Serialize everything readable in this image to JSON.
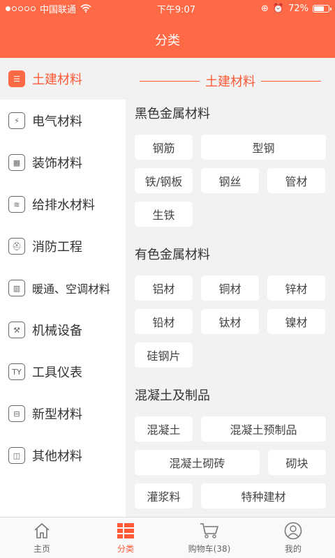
{
  "status": {
    "carrier": "中国联通",
    "time": "下午9:07",
    "battery": "72%",
    "battery_level": 0.72
  },
  "header": {
    "title": "分类"
  },
  "sidebar": {
    "items": [
      {
        "label": "土建材料",
        "icon": "document-icon",
        "active": true
      },
      {
        "label": "电气材料",
        "icon": "electric-icon"
      },
      {
        "label": "装饰材料",
        "icon": "brick-icon"
      },
      {
        "label": "给排水材料",
        "icon": "water-icon"
      },
      {
        "label": "消防工程",
        "icon": "fire-icon"
      },
      {
        "label": "暖通、空调材料",
        "icon": "ac-icon"
      },
      {
        "label": "机械设备",
        "icon": "crane-icon"
      },
      {
        "label": "工具仪表",
        "icon": "tools-icon"
      },
      {
        "label": "新型材料",
        "icon": "new-material-icon"
      },
      {
        "label": "其他材料",
        "icon": "other-icon"
      }
    ]
  },
  "content": {
    "category_title": "土建材料",
    "sections": [
      {
        "title": "黑色金属材料",
        "tags": [
          "钢筋",
          "型钢",
          "铁/钢板",
          "钢丝",
          "管材",
          "生铁"
        ]
      },
      {
        "title": "有色金属材料",
        "tags": [
          "铝材",
          "铜材",
          "锌材",
          "铅材",
          "钛材",
          "镍材",
          "硅钢片"
        ]
      },
      {
        "title": "混凝土及制品",
        "tags": [
          "混凝土",
          "混凝土预制品",
          "混凝土砌砖",
          "砌块",
          "灌浆料",
          "特种建材"
        ]
      }
    ]
  },
  "tabbar": {
    "home": "主页",
    "category": "分类",
    "cart": "购物车(38)",
    "mine": "我的"
  }
}
